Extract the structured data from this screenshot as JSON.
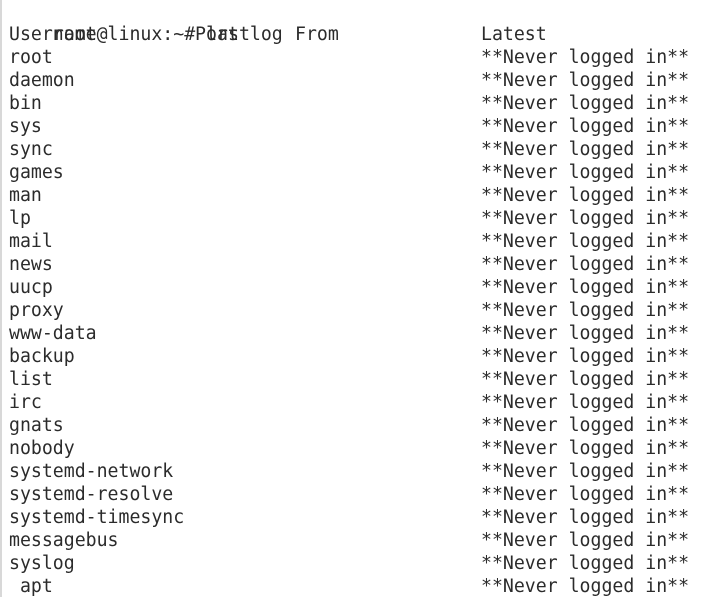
{
  "terminal": {
    "prompt": "root@linux:~# lastlog",
    "headers": {
      "username": "Username",
      "port": "Port",
      "from": "From",
      "latest": "Latest"
    },
    "rows": [
      {
        "user": "root",
        "latest": "**Never logged in**"
      },
      {
        "user": "daemon",
        "latest": "**Never logged in**"
      },
      {
        "user": "bin",
        "latest": "**Never logged in**"
      },
      {
        "user": "sys",
        "latest": "**Never logged in**"
      },
      {
        "user": "sync",
        "latest": "**Never logged in**"
      },
      {
        "user": "games",
        "latest": "**Never logged in**"
      },
      {
        "user": "man",
        "latest": "**Never logged in**"
      },
      {
        "user": "lp",
        "latest": "**Never logged in**"
      },
      {
        "user": "mail",
        "latest": "**Never logged in**"
      },
      {
        "user": "news",
        "latest": "**Never logged in**"
      },
      {
        "user": "uucp",
        "latest": "**Never logged in**"
      },
      {
        "user": "proxy",
        "latest": "**Never logged in**"
      },
      {
        "user": "www-data",
        "latest": "**Never logged in**"
      },
      {
        "user": "backup",
        "latest": "**Never logged in**"
      },
      {
        "user": "list",
        "latest": "**Never logged in**"
      },
      {
        "user": "irc",
        "latest": "**Never logged in**"
      },
      {
        "user": "gnats",
        "latest": "**Never logged in**"
      },
      {
        "user": "nobody",
        "latest": "**Never logged in**"
      },
      {
        "user": "systemd-network",
        "latest": "**Never logged in**"
      },
      {
        "user": "systemd-resolve",
        "latest": "**Never logged in**"
      },
      {
        "user": "systemd-timesync",
        "latest": "**Never logged in**"
      },
      {
        "user": "messagebus",
        "latest": "**Never logged in**"
      },
      {
        "user": "syslog",
        "latest": "**Never logged in**"
      },
      {
        "user": " apt",
        "latest": "**Never logged in**"
      }
    ]
  }
}
